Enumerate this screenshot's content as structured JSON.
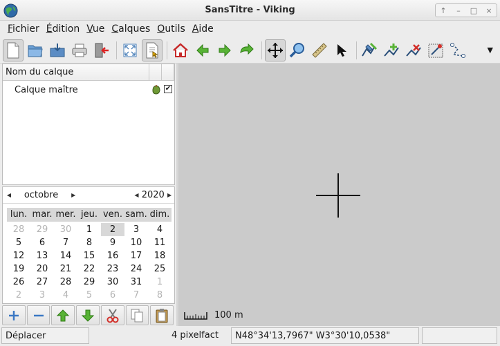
{
  "window": {
    "title": "SansTitre - Viking",
    "controls": [
      "↑",
      "–",
      "□",
      "×"
    ]
  },
  "menu": [
    {
      "mnemonic": "F",
      "rest": "ichier"
    },
    {
      "mnemonic": "É",
      "rest": "dition"
    },
    {
      "mnemonic": "V",
      "rest": "ue"
    },
    {
      "mnemonic": "C",
      "rest": "alques"
    },
    {
      "mnemonic": "O",
      "rest": "utils"
    },
    {
      "mnemonic": "A",
      "rest": "ide"
    }
  ],
  "toolbar": {
    "overflow": "▼",
    "buttons": [
      {
        "name": "new-file-icon"
      },
      {
        "name": "open-folder-icon"
      },
      {
        "name": "save-icon"
      },
      {
        "name": "print-icon"
      },
      {
        "name": "exit-icon"
      },
      {
        "name": "fullscreen-icon"
      },
      {
        "name": "view-mode-icon"
      },
      {
        "name": "home-icon"
      },
      {
        "name": "back-icon"
      },
      {
        "name": "forward-icon"
      },
      {
        "name": "refresh-icon"
      },
      {
        "name": "pan-icon"
      },
      {
        "name": "zoom-icon"
      },
      {
        "name": "ruler-icon"
      },
      {
        "name": "select-icon"
      },
      {
        "name": "edit-track-icon"
      },
      {
        "name": "create-waypoint-icon"
      },
      {
        "name": "edit-waypoint-icon"
      },
      {
        "name": "download-map-icon"
      },
      {
        "name": "route-finder-icon"
      }
    ]
  },
  "layers": {
    "column_name": "Nom du calque",
    "rows": [
      {
        "label": "Calque maître",
        "visible_check": "✔"
      }
    ]
  },
  "calendar": {
    "month": "octobre",
    "year": "2020",
    "weekdays": [
      "lun.",
      "mar.",
      "mer.",
      "jeu.",
      "ven.",
      "sam.",
      "dim."
    ],
    "weeks": [
      [
        "28",
        "29",
        "30",
        "1",
        "2",
        "3",
        "4"
      ],
      [
        "5",
        "6",
        "7",
        "8",
        "9",
        "10",
        "11"
      ],
      [
        "12",
        "13",
        "14",
        "15",
        "16",
        "17",
        "18"
      ],
      [
        "19",
        "20",
        "21",
        "22",
        "23",
        "24",
        "25"
      ],
      [
        "26",
        "27",
        "28",
        "29",
        "30",
        "31",
        "1"
      ],
      [
        "2",
        "3",
        "4",
        "5",
        "6",
        "7",
        "8"
      ]
    ],
    "selected_day": "2"
  },
  "map": {
    "scale_label": "100 m"
  },
  "status": {
    "tool": "Déplacer",
    "zoom": "4 pixelfact",
    "position": "N48°34'13,7967\" W3°30'10,0538\"",
    "extra": ""
  },
  "colors": {
    "map_bg": "#cbcbcb",
    "green_arrow": "#3aa023",
    "home_red": "#d2302a"
  }
}
